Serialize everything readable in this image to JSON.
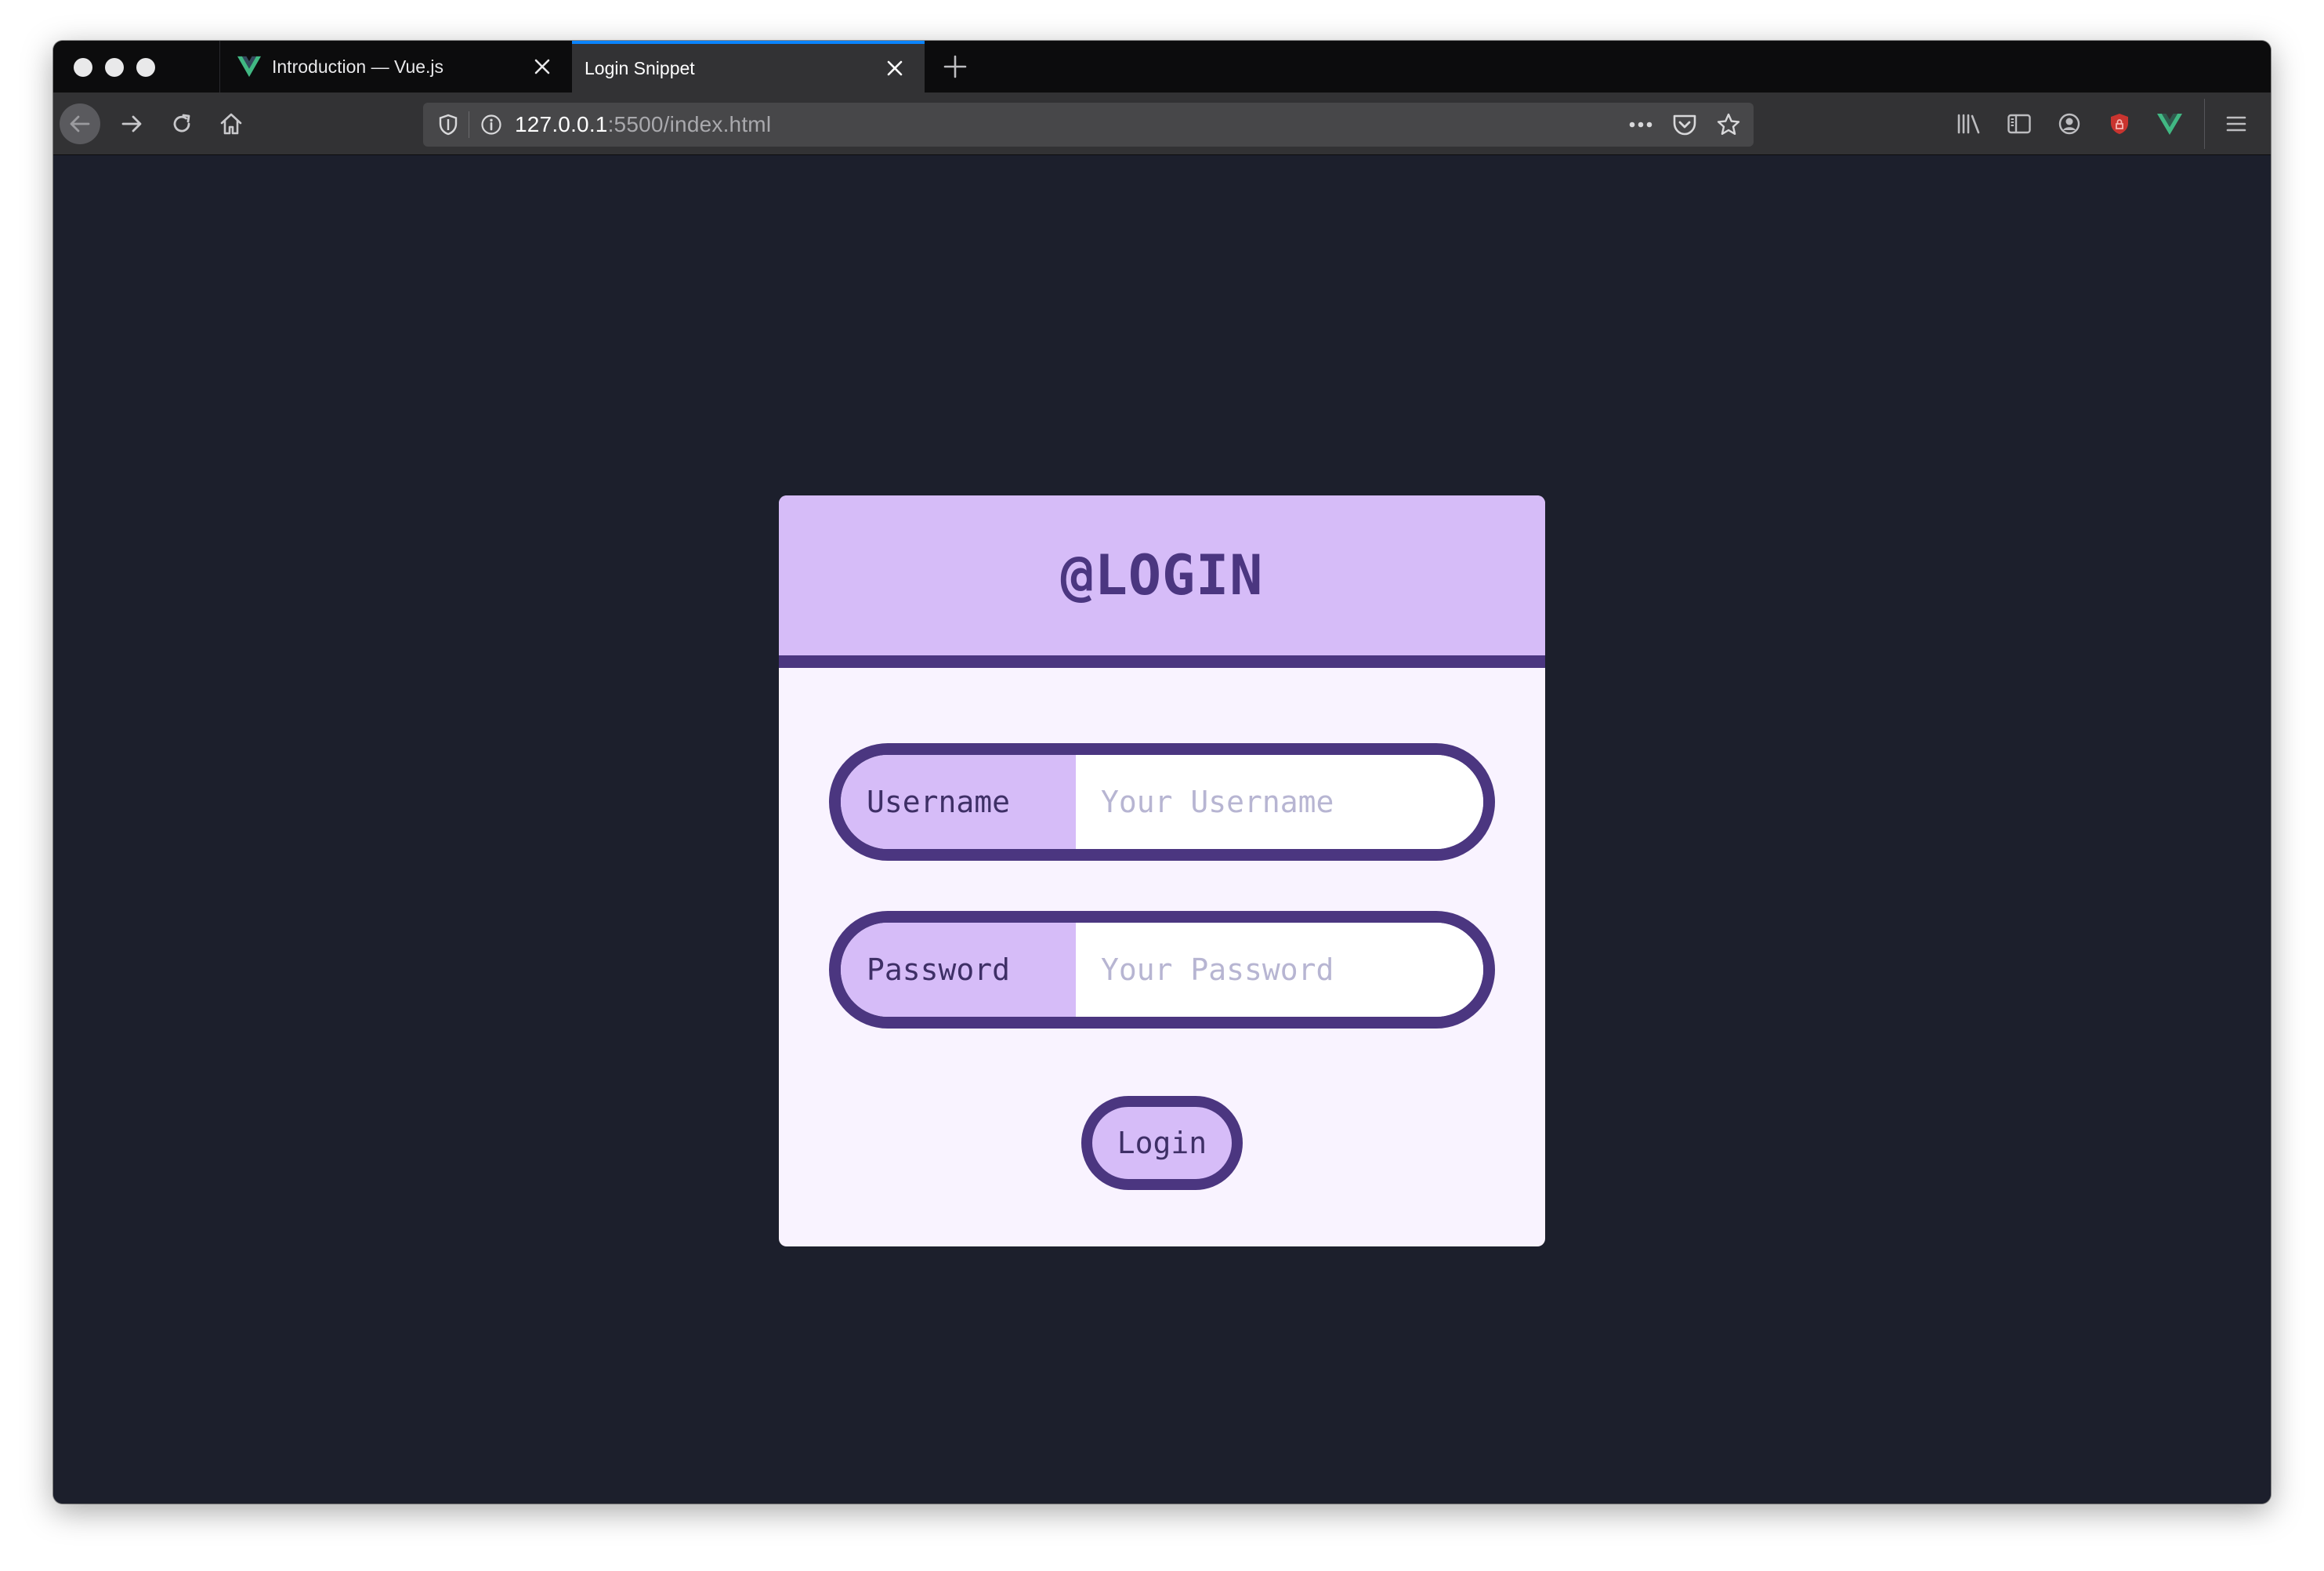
{
  "browser": {
    "tabs": [
      {
        "title": "Introduction — Vue.js",
        "favicon": "vue-logo-icon",
        "active": false
      },
      {
        "title": "Login Snippet",
        "active": true
      }
    ],
    "url_host": "127.0.0.1",
    "url_rest": ":5500/index.html",
    "accent_color": "#0a84ff"
  },
  "page": {
    "background": "#1c1f2c",
    "login_form": {
      "title": "@LOGIN",
      "username": {
        "label": "Username",
        "placeholder": "Your Username",
        "value": ""
      },
      "password": {
        "label": "Password",
        "placeholder": "Your Password",
        "value": ""
      },
      "submit_label": "Login",
      "colors": {
        "primary": "#4b3680",
        "accent": "#d6bcf8",
        "card": "#f9f3ff"
      }
    }
  }
}
